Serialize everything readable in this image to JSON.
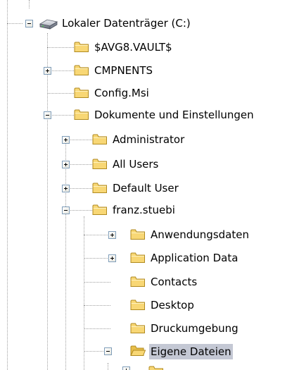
{
  "colors": {
    "selection": "#c4c8d4",
    "folder_fill": "#f8d775",
    "folder_edge": "#b08a20",
    "tree_line": "#a0a0a0"
  },
  "tree": {
    "drive": {
      "label": "Lokaler Datenträger (C:)",
      "icon": "hard-drive-icon",
      "expanded": true
    },
    "items": [
      {
        "label": "$AVG8.VAULT$",
        "icon": "folder-icon",
        "expander": "none"
      },
      {
        "label": "CMPNENTS",
        "icon": "folder-icon",
        "expander": "plus"
      },
      {
        "label": "Config.Msi",
        "icon": "folder-icon",
        "expander": "none"
      },
      {
        "label": "Dokumente und Einstellungen",
        "icon": "folder-icon",
        "expander": "minus",
        "children": [
          {
            "label": "Administrator",
            "icon": "folder-icon",
            "expander": "plus"
          },
          {
            "label": "All Users",
            "icon": "folder-icon",
            "expander": "plus"
          },
          {
            "label": "Default User",
            "icon": "folder-icon",
            "expander": "plus"
          },
          {
            "label": "franz.stuebi",
            "icon": "folder-icon",
            "expander": "minus",
            "children": [
              {
                "label": "Anwendungsdaten",
                "icon": "folder-icon",
                "expander": "plus"
              },
              {
                "label": "Application Data",
                "icon": "folder-icon",
                "expander": "plus"
              },
              {
                "label": "Contacts",
                "icon": "folder-icon",
                "expander": "none"
              },
              {
                "label": "Desktop",
                "icon": "folder-icon",
                "expander": "none"
              },
              {
                "label": "Druckumgebung",
                "icon": "folder-icon",
                "expander": "none"
              },
              {
                "label": "Eigene Dateien",
                "icon": "folder-icon",
                "expander": "minus",
                "selected": true
              }
            ]
          }
        ]
      }
    ]
  }
}
